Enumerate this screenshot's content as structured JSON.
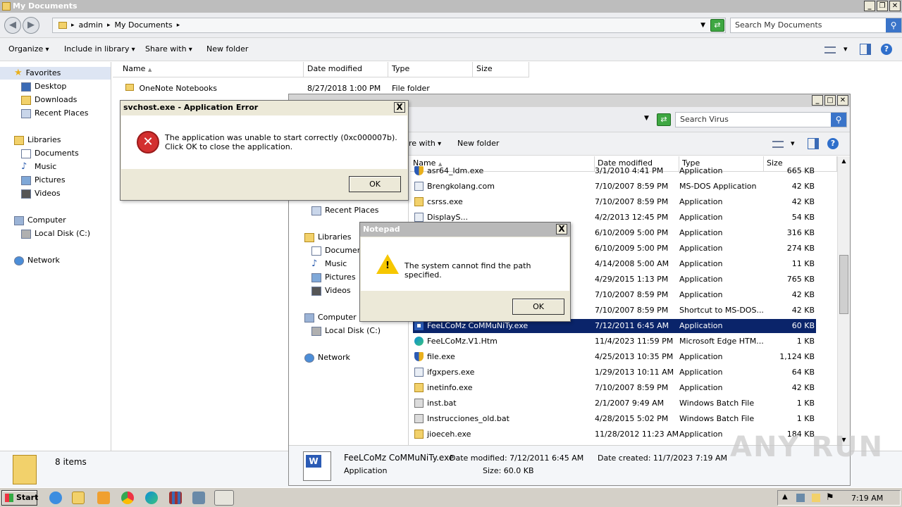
{
  "main_window": {
    "title": "My Documents",
    "breadcrumb": [
      "admin",
      "My Documents"
    ],
    "search_placeholder": "Search My Documents",
    "toolbar": {
      "organize": "Organize",
      "include_in_library": "Include in library",
      "share_with": "Share with",
      "new_folder": "New folder"
    },
    "nav": {
      "favorites": "Favorites",
      "desktop": "Desktop",
      "downloads": "Downloads",
      "recent_places": "Recent Places",
      "libraries": "Libraries",
      "documents": "Documents",
      "music": "Music",
      "pictures": "Pictures",
      "videos": "Videos",
      "computer": "Computer",
      "local_disk": "Local Disk (C:)",
      "network": "Network"
    },
    "columns": {
      "name": "Name",
      "date_modified": "Date modified",
      "type": "Type",
      "size": "Size"
    },
    "files": [
      {
        "name": "OneNote Notebooks",
        "date": "8/27/2018 1:00 PM",
        "type": "File folder",
        "size": ""
      }
    ],
    "status": "8 items"
  },
  "virus_window": {
    "search_placeholder": "Search Virus",
    "toolbar": {
      "share_with": "re with",
      "new_folder": "New folder"
    },
    "nav": {
      "recent_places": "Recent Places",
      "libraries": "Libraries",
      "documents": "Document",
      "music": "Music",
      "pictures": "Pictures",
      "videos": "Videos",
      "computer": "Computer",
      "local_disk": "Local Disk (C:)",
      "network": "Network"
    },
    "columns": {
      "name": "Name",
      "date_modified": "Date modified",
      "type": "Type",
      "size": "Size"
    },
    "files": [
      {
        "name": "asr64_ldm.exe",
        "date": "3/1/2010 4:41 PM",
        "type": "Application",
        "size": "665 KB",
        "icon": "shield-icon"
      },
      {
        "name": "Brengkolang.com",
        "date": "7/10/2007 8:59 PM",
        "type": "MS-DOS Application",
        "size": "42 KB",
        "icon": "exe-icon"
      },
      {
        "name": "csrss.exe",
        "date": "7/10/2007 8:59 PM",
        "type": "Application",
        "size": "42 KB",
        "icon": "folder-icon"
      },
      {
        "name": "DisplayS...",
        "date": "4/2/2013 12:45 PM",
        "type": "Application",
        "size": "54 KB",
        "icon": "exe-icon"
      },
      {
        "name": "",
        "date": "6/10/2009 5:00 PM",
        "type": "Application",
        "size": "316 KB",
        "icon": ""
      },
      {
        "name": "",
        "date": "6/10/2009 5:00 PM",
        "type": "Application",
        "size": "274 KB",
        "icon": ""
      },
      {
        "name": "",
        "date": "4/14/2008 5:00 AM",
        "type": "Application",
        "size": "11 KB",
        "icon": ""
      },
      {
        "name": "",
        "date": "4/29/2015 1:13 PM",
        "type": "Application",
        "size": "765 KB",
        "icon": ""
      },
      {
        "name": "",
        "date": "7/10/2007 8:59 PM",
        "type": "Application",
        "size": "42 KB",
        "icon": ""
      },
      {
        "name": "",
        "date": "7/10/2007 8:59 PM",
        "type": "Shortcut to MS-DOS...",
        "size": "42 KB",
        "icon": ""
      },
      {
        "name": "FeeLCoMz CoMMuNiTy.exe",
        "date": "7/12/2011 6:45 AM",
        "type": "Application",
        "size": "60 KB",
        "icon": "word-icon",
        "selected": true
      },
      {
        "name": "FeeLCoMz.V1.Htm",
        "date": "11/4/2023 11:59 PM",
        "type": "Microsoft Edge HTM...",
        "size": "1 KB",
        "icon": "edge-icon"
      },
      {
        "name": "file.exe",
        "date": "4/25/2013 10:35 PM",
        "type": "Application",
        "size": "1,124 KB",
        "icon": "shield-icon"
      },
      {
        "name": "ifgxpers.exe",
        "date": "1/29/2013 10:11 AM",
        "type": "Application",
        "size": "64 KB",
        "icon": "exe-icon"
      },
      {
        "name": "inetinfo.exe",
        "date": "7/10/2007 8:59 PM",
        "type": "Application",
        "size": "42 KB",
        "icon": "folder-icon"
      },
      {
        "name": "inst.bat",
        "date": "2/1/2007 9:49 AM",
        "type": "Windows Batch File",
        "size": "1 KB",
        "icon": "bat-icon"
      },
      {
        "name": "Instrucciones_old.bat",
        "date": "4/28/2015 5:02 PM",
        "type": "Windows Batch File",
        "size": "1 KB",
        "icon": "bat-icon"
      },
      {
        "name": "jioeceh.exe",
        "date": "11/28/2012 11:23 AM",
        "type": "Application",
        "size": "184 KB",
        "icon": "folder-icon"
      }
    ],
    "details": {
      "name": "FeeLCoMz CoMMuNiTy.exe",
      "kind": "Application",
      "date_modified": "Date modified: 7/12/2011 6:45 AM",
      "size": "Size: 60.0 KB",
      "date_created": "Date created: 11/7/2023 7:19 AM"
    }
  },
  "app_error_dialog": {
    "title": "svchost.exe - Application Error",
    "message": "The application was unable to start correctly (0xc000007b). Click OK to close the application.",
    "ok": "OK",
    "close": "X"
  },
  "notepad_dialog": {
    "title": "Notepad",
    "message": "The system cannot find the path specified.",
    "ok": "OK",
    "close": "X"
  },
  "taskbar": {
    "start": "Start",
    "clock": "7:19 AM"
  },
  "watermark": "ANY RUN",
  "colors": {
    "selection": "#0a246a",
    "error_red": "#d32f2f",
    "warning_yellow": "#f6c700",
    "dialog_bg": "#ece9d8"
  }
}
